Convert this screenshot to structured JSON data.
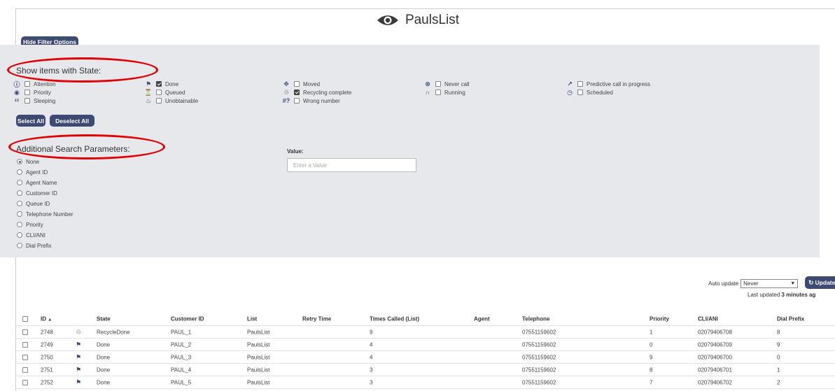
{
  "app": {
    "title": "PaulsList",
    "icon": "eye-icon"
  },
  "colors": {
    "button_bg": "#3d4a73",
    "panel_bg": "#e6e8ec",
    "annotation": "#e00000"
  },
  "toolbar": {
    "hide_filter_label": "Hide Filter Options"
  },
  "state_filter": {
    "heading": "Show items with State:",
    "items": [
      {
        "icon": "alert-circle-icon",
        "glyph": "ⓘ",
        "label": "Attention",
        "checked": false
      },
      {
        "icon": "priority-target-icon",
        "glyph": "◉",
        "label": "Priority",
        "checked": false
      },
      {
        "icon": "sleeping-icon",
        "glyph": "ᶻᶻ",
        "label": "Sleeping",
        "checked": false
      },
      {
        "icon": "flag-icon",
        "glyph": "⚑",
        "label": "Done",
        "checked": true
      },
      {
        "icon": "hourglass-icon",
        "glyph": "⏳",
        "label": "Queued",
        "checked": false
      },
      {
        "icon": "unobtainable-icon",
        "glyph": "♨",
        "label": "Unobtainable",
        "checked": false
      },
      {
        "icon": "move-arrows-icon",
        "glyph": "✥",
        "label": "Moved",
        "checked": false
      },
      {
        "icon": "recycle-icon",
        "glyph": "♲",
        "label": "Recycling complete",
        "checked": true
      },
      {
        "icon": "wrong-number-icon",
        "glyph": "#?",
        "label": "Wrong number",
        "checked": false
      },
      {
        "icon": "never-call-icon",
        "glyph": "⊗",
        "label": "Never call",
        "checked": false
      },
      {
        "icon": "headset-icon",
        "glyph": "∩",
        "label": "Running",
        "checked": false
      },
      {
        "icon": "predictive-call-icon",
        "glyph": "↗",
        "label": "Predictive call in progress",
        "checked": false
      },
      {
        "icon": "clock-icon",
        "glyph": "◷",
        "label": "Scheduled",
        "checked": false
      }
    ],
    "select_all_label": "Select All",
    "deselect_all_label": "Deselect All"
  },
  "search_params": {
    "heading": "Additional Search Parameters:",
    "options": [
      "None",
      "Agent ID",
      "Agent Name",
      "Customer ID",
      "Queue ID",
      "Telephone Number",
      "Priority",
      "CLI/ANI",
      "Dial Prefix"
    ],
    "selected": "None",
    "value_label": "Value:",
    "value_placeholder": "Enter a Value"
  },
  "update": {
    "auto_update_label": "Auto update",
    "auto_update_value": "Never",
    "update_button_label": "Update",
    "last_updated_prefix": "Last updated ",
    "last_updated_value": "3 minutes ag"
  },
  "table": {
    "columns": [
      "ID",
      "State",
      "Customer ID",
      "List",
      "Retry Time",
      "Times Called (List)",
      "Agent",
      "Telephone",
      "Priority",
      "CLI/ANI",
      "Dial Prefix"
    ],
    "sort_indicator": "▲",
    "rows": [
      {
        "id": "2748",
        "state_icon": "recycle-icon",
        "glyph": "♲",
        "state": "RecycleDone",
        "customer_id": "PAUL_1",
        "list": "PaulsList",
        "retry_time": "",
        "times_called": "9",
        "agent": "",
        "telephone": "07551159602",
        "priority": "1",
        "cli": "02079406708",
        "dial_prefix": "8"
      },
      {
        "id": "2749",
        "state_icon": "flag-icon",
        "glyph": "⚑",
        "state": "Done",
        "customer_id": "PAUL_2",
        "list": "PaulsList",
        "retry_time": "",
        "times_called": "4",
        "agent": "",
        "telephone": "07551159602",
        "priority": "0",
        "cli": "02079406709",
        "dial_prefix": "9"
      },
      {
        "id": "2750",
        "state_icon": "flag-icon",
        "glyph": "⚑",
        "state": "Done",
        "customer_id": "PAUL_3",
        "list": "PaulsList",
        "retry_time": "",
        "times_called": "4",
        "agent": "",
        "telephone": "07551159602",
        "priority": "9",
        "cli": "02079406700",
        "dial_prefix": "0"
      },
      {
        "id": "2751",
        "state_icon": "flag-icon",
        "glyph": "⚑",
        "state": "Done",
        "customer_id": "PAUL_4",
        "list": "PaulsList",
        "retry_time": "",
        "times_called": "3",
        "agent": "",
        "telephone": "07551159602",
        "priority": "8",
        "cli": "02079406701",
        "dial_prefix": "1"
      },
      {
        "id": "2752",
        "state_icon": "flag-icon",
        "glyph": "⚑",
        "state": "Done",
        "customer_id": "PAUL_5",
        "list": "PaulsList",
        "retry_time": "",
        "times_called": "3",
        "agent": "",
        "telephone": "07551159602",
        "priority": "7",
        "cli": "02079406702",
        "dial_prefix": "2"
      }
    ]
  }
}
